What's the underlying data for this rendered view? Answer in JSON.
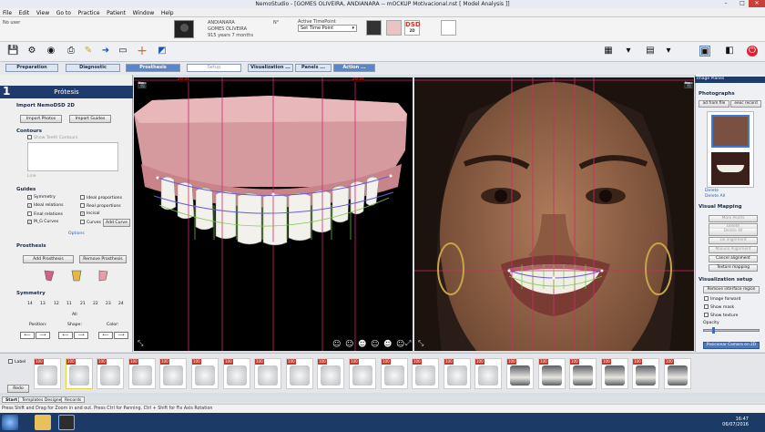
{
  "window": {
    "title": "NemoStudio - [GOMES OLIVEIRA, ANDIANARA -- mOCKUP Motivacional.nst [ Model Analysis ]]",
    "user": "No user"
  },
  "menu": [
    "File",
    "Edit",
    "View",
    "Go to",
    "Practice",
    "Patient",
    "Window",
    "Help"
  ],
  "patient": {
    "first_name": "ANDIANARA",
    "last_name": "GOMES OLIVEIRA",
    "age": "915 years 7 months",
    "no_label": "N°"
  },
  "timepoint": {
    "label": "Active TimePoint",
    "value": "Set Time Point"
  },
  "dsd_logo": "DSD",
  "dsd_sub": "2D",
  "mode_tabs": [
    {
      "label": "Preparation",
      "state": "normal"
    },
    {
      "label": "Diagnostic",
      "state": "normal"
    },
    {
      "label": "Prosthesis",
      "state": "active"
    },
    {
      "label": "Setup",
      "state": "disabled"
    },
    {
      "label": "Visualization ...",
      "state": "normal"
    },
    {
      "label": "Panels ...",
      "state": "normal"
    },
    {
      "label": "Action ...",
      "state": "active2"
    }
  ],
  "left_panel": {
    "step_number": "1",
    "title": "Prótesis",
    "import_section": "Import NemoDSD 2D",
    "import_photos": "Import Photos",
    "import_guides": "Import Guides",
    "contours_section": "Contours",
    "show_teeth_contours": "Show Teeth Contours",
    "line_label": "Line",
    "guides_section": "Guides",
    "guides": [
      {
        "label": "Symmetry",
        "checked": true
      },
      {
        "label": "Ideal proportions",
        "checked": false
      },
      {
        "label": "Ideal relations",
        "checked": true
      },
      {
        "label": "Real proportions",
        "checked": false
      },
      {
        "label": "Final relations",
        "checked": false
      },
      {
        "label": "Incisal",
        "checked": true
      },
      {
        "label": "M_G Curves",
        "checked": true
      },
      {
        "label": "Curves",
        "checked": false
      }
    ],
    "add_curve": "Add Curve",
    "options_link": "Options",
    "prosthesis_section": "Prosthesis",
    "add_prosthesis": "Add Prosthesis",
    "remove_prosthesis": "Remove Prosthesis",
    "symmetry_section": "Symmetry",
    "tooth_numbers": [
      "14",
      "13",
      "12",
      "11",
      "21",
      "22",
      "23",
      "24"
    ],
    "all_label": "All",
    "position_label": "Position:",
    "shape_label": "Shape:",
    "color_label": "Color:"
  },
  "viewport_left": {
    "measure_left": "20.31",
    "measure_right": "20.31"
  },
  "viewport_right": {
    "measure_left": "",
    "measure_right": ""
  },
  "right_panel": {
    "header": "Image Planes",
    "photographs_section": "Photographs",
    "add_from_file": "ad from file",
    "webcam_record": "eeoc record",
    "delete_link": "Delete",
    "delete_all_link": "Delete All",
    "visual_mapping_section": "Visual Mapping",
    "mark_points": "Mark Points",
    "delete": "Delete",
    "delete_all": "Delete All",
    "do_alignment": "Do alignment",
    "manual_alignment": "Manual Alignment",
    "cancel_alignment": "Cancel alignment",
    "texture_mapping": "Texture mapping",
    "vis_setup_section": "Visualization setup",
    "remove_interface": "Remove interface region",
    "image_forward": "Image forward",
    "show_mask": "Show mask",
    "show_texture": "Show texture",
    "opacity_label": "Opacity",
    "opacity_value": 0.15,
    "position_camera": "Posicionar Camara en 2D"
  },
  "filmstrip": {
    "label": "Label",
    "redo": "Redo",
    "thumbs": [
      "100",
      "100",
      "100",
      "100",
      "100",
      "100",
      "100",
      "100",
      "100",
      "100",
      "100",
      "100",
      "100",
      "100",
      "100",
      "100",
      "100",
      "100",
      "100",
      "100",
      "100"
    ]
  },
  "bottom_tabs": [
    "Start",
    "Templates Designer",
    "Records"
  ],
  "status_text": "Press Shift and Drag for Zoom in and out. Press Ctrl for Panning. Ctrl + Shift for Fix Axis Rotation",
  "clock": {
    "time": "16:47",
    "date": "06/07/2016"
  },
  "colors": {
    "accent": "#1e3b6e",
    "active_tab": "#5b86c9",
    "swatch1": "#d45f8a",
    "swatch2": "#e5b73e",
    "swatch3": "#e8a0a8"
  }
}
